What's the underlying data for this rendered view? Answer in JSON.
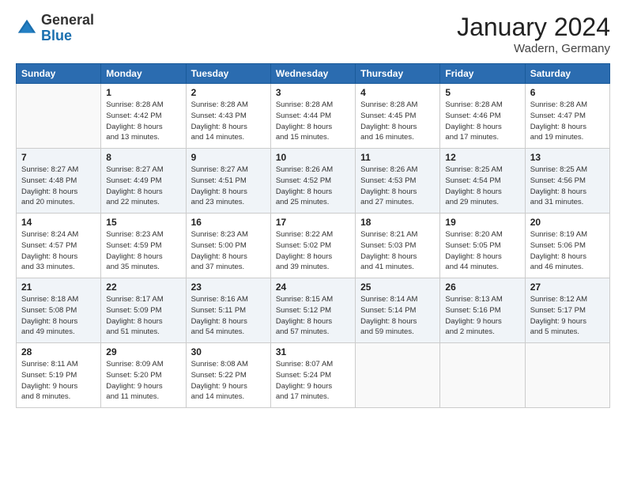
{
  "header": {
    "logo_general": "General",
    "logo_blue": "Blue",
    "month_title": "January 2024",
    "location": "Wadern, Germany"
  },
  "weekdays": [
    "Sunday",
    "Monday",
    "Tuesday",
    "Wednesday",
    "Thursday",
    "Friday",
    "Saturday"
  ],
  "weeks": [
    [
      {
        "day": "",
        "info": ""
      },
      {
        "day": "1",
        "info": "Sunrise: 8:28 AM\nSunset: 4:42 PM\nDaylight: 8 hours\nand 13 minutes."
      },
      {
        "day": "2",
        "info": "Sunrise: 8:28 AM\nSunset: 4:43 PM\nDaylight: 8 hours\nand 14 minutes."
      },
      {
        "day": "3",
        "info": "Sunrise: 8:28 AM\nSunset: 4:44 PM\nDaylight: 8 hours\nand 15 minutes."
      },
      {
        "day": "4",
        "info": "Sunrise: 8:28 AM\nSunset: 4:45 PM\nDaylight: 8 hours\nand 16 minutes."
      },
      {
        "day": "5",
        "info": "Sunrise: 8:28 AM\nSunset: 4:46 PM\nDaylight: 8 hours\nand 17 minutes."
      },
      {
        "day": "6",
        "info": "Sunrise: 8:28 AM\nSunset: 4:47 PM\nDaylight: 8 hours\nand 19 minutes."
      }
    ],
    [
      {
        "day": "7",
        "info": "Sunrise: 8:27 AM\nSunset: 4:48 PM\nDaylight: 8 hours\nand 20 minutes."
      },
      {
        "day": "8",
        "info": "Sunrise: 8:27 AM\nSunset: 4:49 PM\nDaylight: 8 hours\nand 22 minutes."
      },
      {
        "day": "9",
        "info": "Sunrise: 8:27 AM\nSunset: 4:51 PM\nDaylight: 8 hours\nand 23 minutes."
      },
      {
        "day": "10",
        "info": "Sunrise: 8:26 AM\nSunset: 4:52 PM\nDaylight: 8 hours\nand 25 minutes."
      },
      {
        "day": "11",
        "info": "Sunrise: 8:26 AM\nSunset: 4:53 PM\nDaylight: 8 hours\nand 27 minutes."
      },
      {
        "day": "12",
        "info": "Sunrise: 8:25 AM\nSunset: 4:54 PM\nDaylight: 8 hours\nand 29 minutes."
      },
      {
        "day": "13",
        "info": "Sunrise: 8:25 AM\nSunset: 4:56 PM\nDaylight: 8 hours\nand 31 minutes."
      }
    ],
    [
      {
        "day": "14",
        "info": "Sunrise: 8:24 AM\nSunset: 4:57 PM\nDaylight: 8 hours\nand 33 minutes."
      },
      {
        "day": "15",
        "info": "Sunrise: 8:23 AM\nSunset: 4:59 PM\nDaylight: 8 hours\nand 35 minutes."
      },
      {
        "day": "16",
        "info": "Sunrise: 8:23 AM\nSunset: 5:00 PM\nDaylight: 8 hours\nand 37 minutes."
      },
      {
        "day": "17",
        "info": "Sunrise: 8:22 AM\nSunset: 5:02 PM\nDaylight: 8 hours\nand 39 minutes."
      },
      {
        "day": "18",
        "info": "Sunrise: 8:21 AM\nSunset: 5:03 PM\nDaylight: 8 hours\nand 41 minutes."
      },
      {
        "day": "19",
        "info": "Sunrise: 8:20 AM\nSunset: 5:05 PM\nDaylight: 8 hours\nand 44 minutes."
      },
      {
        "day": "20",
        "info": "Sunrise: 8:19 AM\nSunset: 5:06 PM\nDaylight: 8 hours\nand 46 minutes."
      }
    ],
    [
      {
        "day": "21",
        "info": "Sunrise: 8:18 AM\nSunset: 5:08 PM\nDaylight: 8 hours\nand 49 minutes."
      },
      {
        "day": "22",
        "info": "Sunrise: 8:17 AM\nSunset: 5:09 PM\nDaylight: 8 hours\nand 51 minutes."
      },
      {
        "day": "23",
        "info": "Sunrise: 8:16 AM\nSunset: 5:11 PM\nDaylight: 8 hours\nand 54 minutes."
      },
      {
        "day": "24",
        "info": "Sunrise: 8:15 AM\nSunset: 5:12 PM\nDaylight: 8 hours\nand 57 minutes."
      },
      {
        "day": "25",
        "info": "Sunrise: 8:14 AM\nSunset: 5:14 PM\nDaylight: 8 hours\nand 59 minutes."
      },
      {
        "day": "26",
        "info": "Sunrise: 8:13 AM\nSunset: 5:16 PM\nDaylight: 9 hours\nand 2 minutes."
      },
      {
        "day": "27",
        "info": "Sunrise: 8:12 AM\nSunset: 5:17 PM\nDaylight: 9 hours\nand 5 minutes."
      }
    ],
    [
      {
        "day": "28",
        "info": "Sunrise: 8:11 AM\nSunset: 5:19 PM\nDaylight: 9 hours\nand 8 minutes."
      },
      {
        "day": "29",
        "info": "Sunrise: 8:09 AM\nSunset: 5:20 PM\nDaylight: 9 hours\nand 11 minutes."
      },
      {
        "day": "30",
        "info": "Sunrise: 8:08 AM\nSunset: 5:22 PM\nDaylight: 9 hours\nand 14 minutes."
      },
      {
        "day": "31",
        "info": "Sunrise: 8:07 AM\nSunset: 5:24 PM\nDaylight: 9 hours\nand 17 minutes."
      },
      {
        "day": "",
        "info": ""
      },
      {
        "day": "",
        "info": ""
      },
      {
        "day": "",
        "info": ""
      }
    ]
  ]
}
